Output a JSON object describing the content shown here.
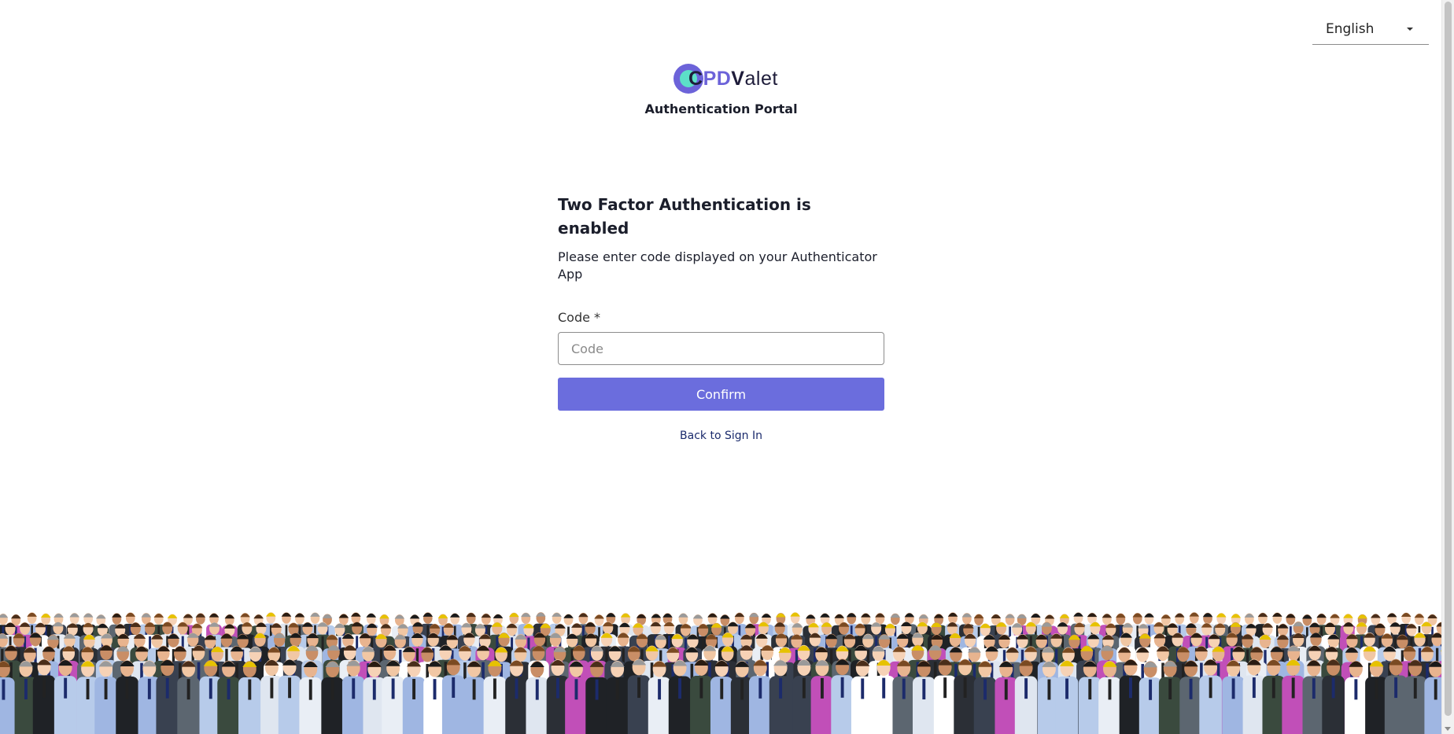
{
  "language": {
    "selected": "English"
  },
  "brand": {
    "logo_parts": [
      "C",
      "PD",
      "V",
      "alet"
    ],
    "portal_title": "Authentication Portal",
    "colors": {
      "primary": "#6b6ddd",
      "accent": "#5ce0c8",
      "dark": "#1e1c3a"
    }
  },
  "form": {
    "title": "Two Factor Authentication is enabled",
    "subtitle": "Please enter code displayed on your Authenticator App",
    "code_label": "Code *",
    "code_placeholder": "Code",
    "code_value": "",
    "confirm_label": "Confirm",
    "back_link": "Back to Sign In"
  },
  "footer": {
    "illustration": "crowd-of-professionals"
  }
}
